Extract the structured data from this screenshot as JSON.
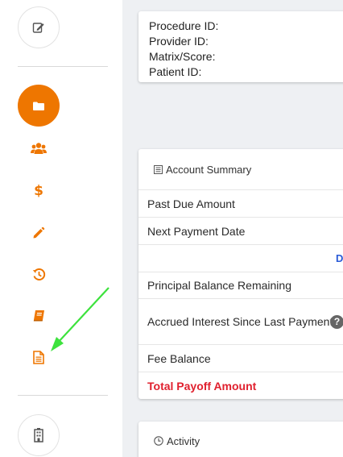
{
  "ids_panel": {
    "procedure_label": "Procedure ID:",
    "provider_label": "Provider ID:",
    "matrix_label": "Matrix/Score:",
    "patient_label": "Patient ID:"
  },
  "account_summary": {
    "title": "Account Summary",
    "past_due": "Past Due Amount",
    "next_payment": "Next Payment Date",
    "link_partial": "D",
    "principal": "Principal Balance Remaining",
    "accrued_interest": "Accrued Interest Since Last Payment",
    "help_symbol": "?",
    "fee_balance": "Fee Balance",
    "total_payoff": "Total Payoff Amount"
  },
  "activity": {
    "title": "Activity"
  },
  "colors": {
    "accent": "#ee7600",
    "payoff": "#e0202e",
    "annotation_arrow": "#3de23d"
  },
  "sidebar": {
    "icons": [
      "edit-icon",
      "folder-icon",
      "users-icon",
      "dollar-icon",
      "pencil-icon",
      "history-icon",
      "book-icon",
      "document-icon",
      "building-icon"
    ],
    "dollar_symbol": "$"
  }
}
